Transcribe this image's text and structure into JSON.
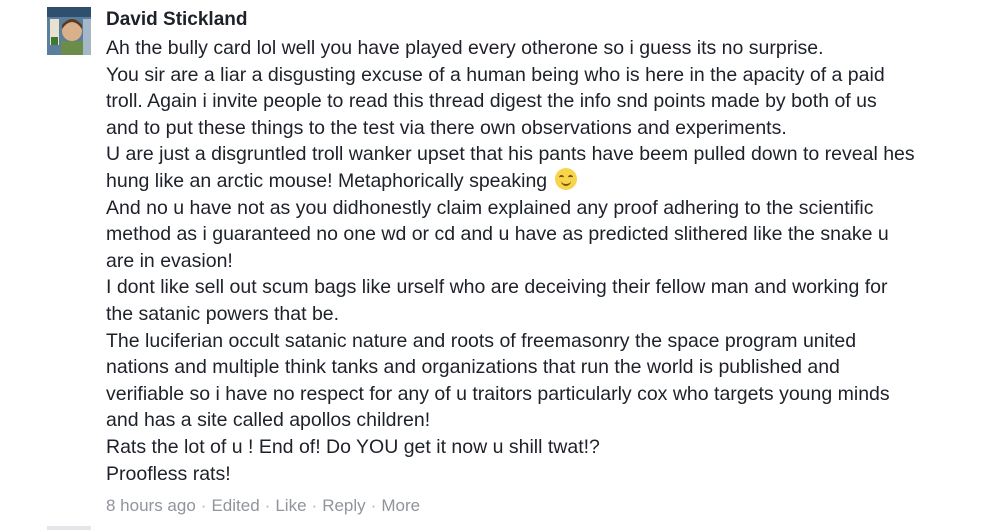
{
  "comment": {
    "author": "David Stickland",
    "avatar_icon": "profile-photo-icon",
    "lines": [
      "Ah the bully card lol well you have played every otherone so i guess its no surprise.",
      "You sir are a liar a disgusting excuse of a human being who is here in the apacity of a paid",
      "troll. Again i invite people to read this thread digest the info snd points made by both of us",
      "and to put these things to the test via there own observations and experiments.",
      "U are just a disgruntled troll wanker upset that his pants have beem pulled down to reveal hes",
      "hung like an arctic mouse! Metaphorically speaking",
      "And no u have not as you didhonestly claim explained any proof adhering to the scientific",
      "method as i guaranteed no one wd or cd and u have as predicted slithered like the snake u",
      "are in evasion!",
      "I dont like sell out scum bags like urself who are deceiving their fellow man and working for",
      "the satanic powers that be.",
      "The luciferian occult satanic nature and roots of freemasonry the space program united",
      "nations and multiple think tanks and organizations that run the world is published and",
      "verifiable so i have no respect for any of u traitors particularly cox who targets young minds",
      "and has a site called apollos children!",
      "Rats the lot of u ! End of! Do YOU get it now u shill twat!?",
      "Proofless rats!"
    ],
    "emoji_icon": "smiling-face-emoji-icon"
  },
  "meta": {
    "time": "8 hours ago",
    "edited": "Edited",
    "like": "Like",
    "reply": "Reply",
    "more": "More",
    "separator": "·"
  },
  "colors": {
    "author": "#1d2129",
    "text": "#1d2129",
    "meta": "#90949c"
  }
}
